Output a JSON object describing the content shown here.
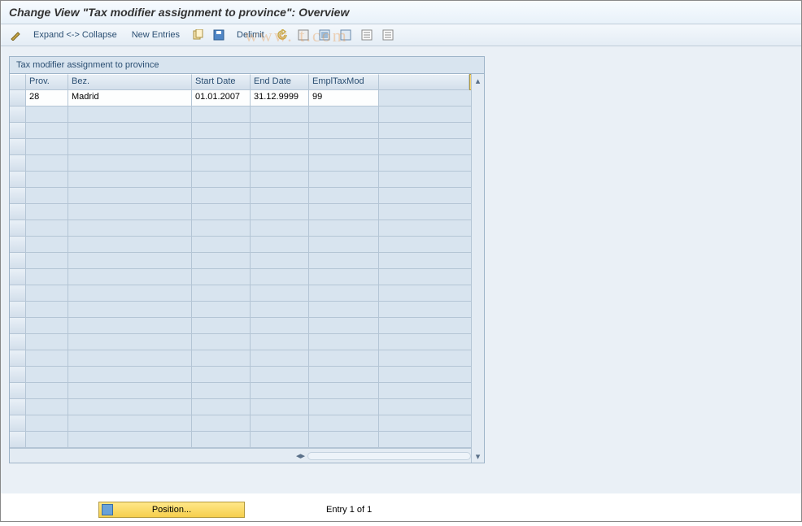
{
  "title": "Change View \"Tax modifier assignment to province\": Overview",
  "toolbar": {
    "expand_collapse": "Expand <-> Collapse",
    "new_entries": "New Entries",
    "delimit": "Delimit"
  },
  "panel_title": "Tax modifier assignment to province",
  "columns": {
    "prov": "Prov.",
    "bez": "Bez.",
    "start": "Start Date",
    "end": "End Date",
    "mod": "EmplTaxMod"
  },
  "rows": [
    {
      "prov": "28",
      "bez": "Madrid",
      "start": "01.01.2007",
      "end": "31.12.9999",
      "mod": "99"
    }
  ],
  "empty_row_count": 21,
  "footer": {
    "position_btn": "Position...",
    "entry_text": "Entry 1 of 1"
  },
  "watermark": "www.            t.com"
}
